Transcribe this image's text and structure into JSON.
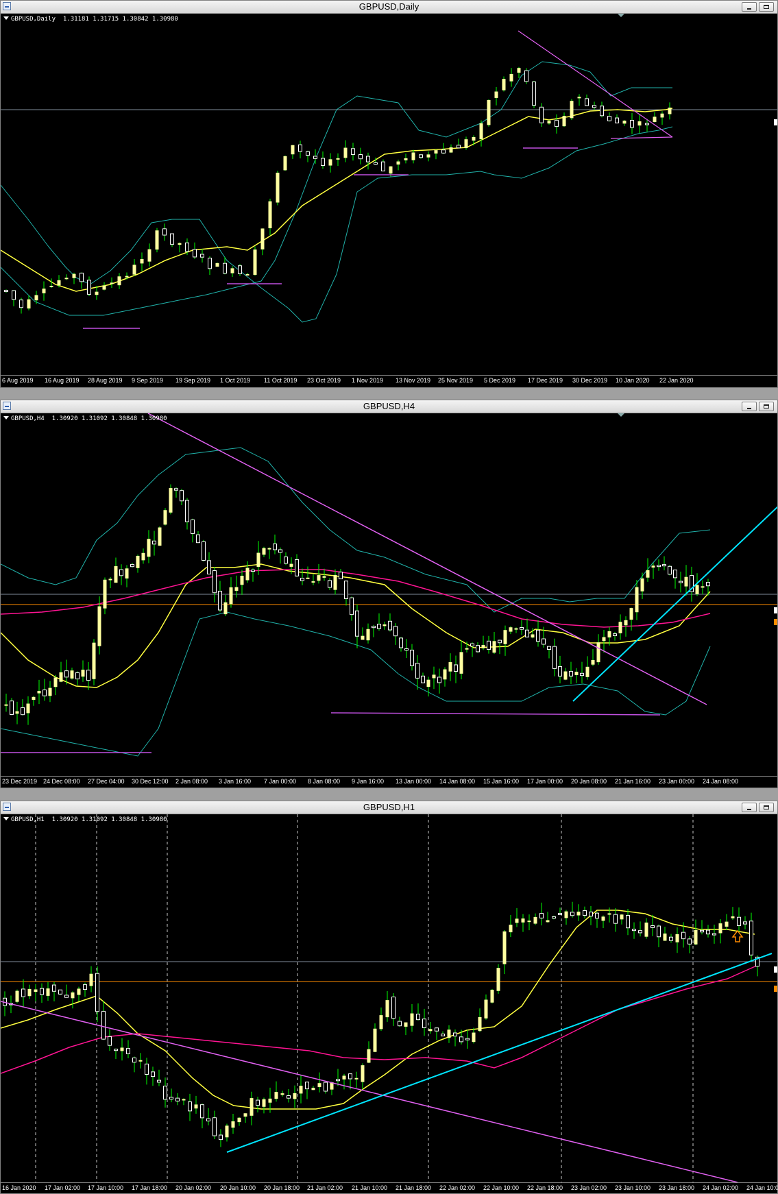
{
  "windows": [
    {
      "id": "daily",
      "title": "GBPUSD,Daily",
      "info": "GBPUSD,Daily  1.31181 1.31715 1.30842 1.30980",
      "x_labels": [
        "6 Aug 2019",
        "16 Aug 2019",
        "28 Aug 2019",
        "9 Sep 2019",
        "19 Sep 2019",
        "1 Oct 2019",
        "11 Oct 2019",
        "23 Oct 2019",
        "1 Nov 2019",
        "13 Nov 2019",
        "25 Nov 2019",
        "5 Dec 2019",
        "17 Dec 2019",
        "30 Dec 2019",
        "10 Jan 2020",
        "22 Jan 2020"
      ]
    },
    {
      "id": "h4",
      "title": "GBPUSD,H4",
      "info": "GBPUSD,H4  1.30920 1.31092 1.30848 1.30980",
      "x_labels": [
        "23 Dec 2019",
        "24 Dec 08:00",
        "27 Dec 04:00",
        "30 Dec 12:00",
        "2 Jan 08:00",
        "3 Jan 16:00",
        "7 Jan 00:00",
        "8 Jan 08:00",
        "9 Jan 16:00",
        "13 Jan 00:00",
        "14 Jan 08:00",
        "15 Jan 16:00",
        "17 Jan 00:00",
        "20 Jan 08:00",
        "21 Jan 16:00",
        "23 Jan 00:00",
        "24 Jan 08:00"
      ]
    },
    {
      "id": "h1",
      "title": "GBPUSD,H1",
      "info": "GBPUSD,H1  1.30920 1.31092 1.30848 1.30980",
      "x_labels": [
        "16 Jan 2020",
        "17 Jan 02:00",
        "17 Jan 10:00",
        "17 Jan 18:00",
        "20 Jan 02:00",
        "20 Jan 10:00",
        "20 Jan 18:00",
        "21 Jan 02:00",
        "21 Jan 10:00",
        "21 Jan 18:00",
        "22 Jan 02:00",
        "22 Jan 10:00",
        "22 Jan 18:00",
        "23 Jan 02:00",
        "23 Jan 10:00",
        "23 Jan 18:00",
        "24 Jan 02:00",
        "24 Jan 10:0"
      ]
    }
  ],
  "colors": {
    "bull": "#ffffa0",
    "bear": "#ffffff",
    "wick": "#00ff00",
    "bands": "#20b2aa",
    "ma_yellow": "#ffff40",
    "ma_magenta": "#ff1493",
    "trend_violet": "#e060f0",
    "trend_cyan": "#00e5ff",
    "support_violet": "#c050e0",
    "bid_line": "#7f8c9a",
    "orange_level": "#ff8c00"
  },
  "icons": [
    "window-icon",
    "minimize-icon",
    "maximize-icon",
    "up-arrow-icon"
  ]
}
